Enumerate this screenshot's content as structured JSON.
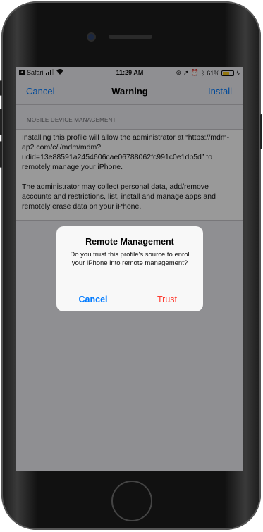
{
  "status_bar": {
    "carrier": "Safari",
    "time": "11:29 AM",
    "battery_percent": "61%",
    "battery_level": 0.61,
    "icons": [
      "back-arrow-icon",
      "signal-bars-icon",
      "wifi-icon",
      "lock-rotation-icon",
      "location-icon",
      "alarm-icon",
      "bluetooth-icon",
      "battery-icon",
      "charging-icon"
    ]
  },
  "navbar": {
    "cancel_label": "Cancel",
    "title": "Warning",
    "install_label": "Install"
  },
  "section": {
    "header": "MOBILE DEVICE MANAGEMENT",
    "paragraph1": "Installing this profile will allow the administrator at “https://mdm-ap2                    com/c/i/mdm/mdm?udid=13e88591a2454606cae06788062fc991c0e1db5d” to remotely manage your iPhone.",
    "paragraph2": "The administrator may collect personal data, add/remove accounts and restrictions, list, install and manage apps and remotely erase data on your iPhone."
  },
  "alert": {
    "title": "Remote Management",
    "message": "Do you trust this profile's source to enrol your iPhone into remote management?",
    "cancel_label": "Cancel",
    "trust_label": "Trust"
  },
  "colors": {
    "accent": "#007aff",
    "destructive": "#ff3b30",
    "battery": "#f5c518"
  }
}
